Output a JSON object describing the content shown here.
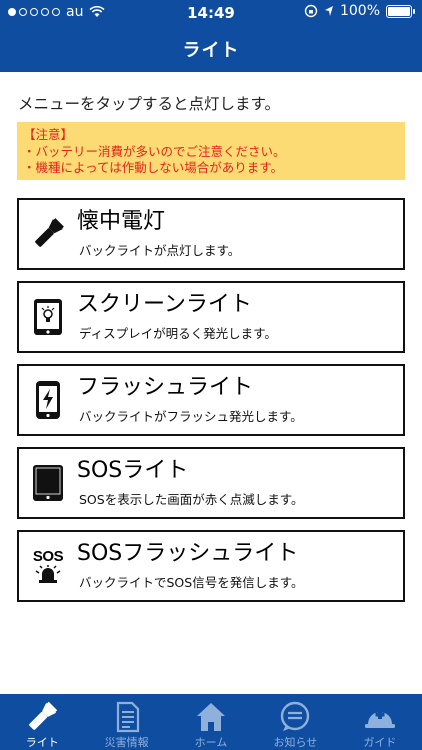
{
  "status_bar": {
    "carrier": "au",
    "time": "14:49",
    "battery": "100%"
  },
  "header": {
    "title": "ライト"
  },
  "instruction": "メニューをタップすると点灯します。",
  "notice": {
    "heading": "【注意】",
    "lines": [
      "・バッテリー消費が多いのでご注意ください。",
      "・機種によっては作動しない場合があります。"
    ]
  },
  "menu": [
    {
      "title": "懐中電灯",
      "description": "バックライトが点灯します。",
      "icon": "flashlight-icon"
    },
    {
      "title": "スクリーンライト",
      "description": "ディスプレイが明るく発光します。",
      "icon": "screen-bulb-icon"
    },
    {
      "title": "フラッシュライト",
      "description": "バックライトがフラッシュ発光します。",
      "icon": "phone-flash-icon"
    },
    {
      "title": "SOSライト",
      "description": "SOSを表示した画面が赤く点滅します。",
      "icon": "tablet-icon"
    },
    {
      "title": "SOSフラッシュライト",
      "description": "バックライトでSOS信号を発信します。",
      "icon": "sos-siren-icon",
      "icon_text": "SOS"
    }
  ],
  "tabs": [
    {
      "label": "ライト",
      "icon": "flashlight-icon",
      "active": true
    },
    {
      "label": "災害情報",
      "icon": "document-icon",
      "active": false
    },
    {
      "label": "ホーム",
      "icon": "home-icon",
      "active": false
    },
    {
      "label": "お知らせ",
      "icon": "message-icon",
      "active": false
    },
    {
      "label": "ガイド",
      "icon": "helmet-icon",
      "active": false
    }
  ],
  "colors": {
    "brand_blue": "#0f4da1",
    "notice_bg": "#fddb74",
    "notice_text": "#e3261c",
    "tab_inactive": "#8fb0da"
  }
}
